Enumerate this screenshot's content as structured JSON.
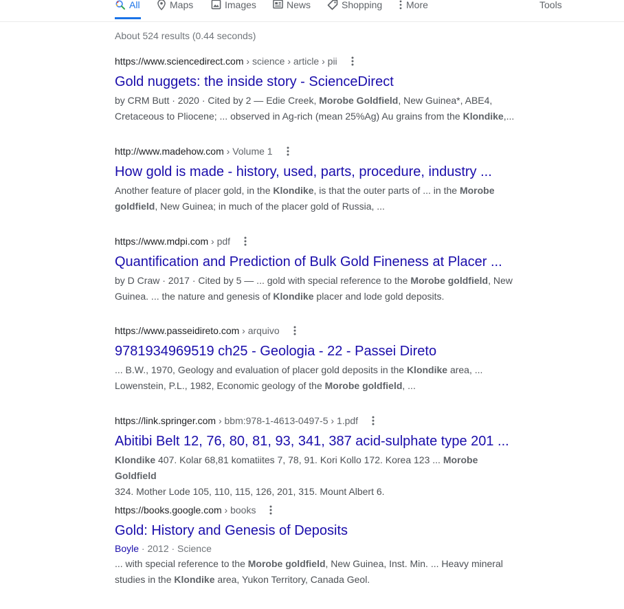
{
  "tabs": {
    "all": "All",
    "maps": "Maps",
    "images": "Images",
    "news": "News",
    "shopping": "Shopping",
    "more": "More",
    "tools": "Tools"
  },
  "stats": "About 524 results (0.44 seconds)",
  "colors": {
    "accent": "#1a73e8",
    "link": "#1a0dab"
  },
  "results": [
    {
      "domain": "https://www.sciencedirect.com",
      "path": " › science › article › pii",
      "title": "Gold nuggets: the inside story - ScienceDirect",
      "snippet": [
        "by CRM Butt · 2020 · Cited by 2 — Edie Creek, ",
        {
          "b": "Morobe Goldfield"
        },
        ", New Guinea*, ABE4,",
        {
          "br": true
        },
        "Cretaceous to Pliocene; ... observed in Ag-rich (mean 25%Ag) Au grains from the ",
        {
          "b": "Klondike"
        },
        ",..."
      ]
    },
    {
      "domain": "http://www.madehow.com",
      "path": " › Volume 1",
      "title": "How gold is made - history, used, parts, procedure, industry ...",
      "snippet": [
        "Another feature of placer gold, in the ",
        {
          "b": "Klondike"
        },
        ", is that the outer parts of ... in the ",
        {
          "b": "Morobe"
        },
        {
          "br": true
        },
        {
          "b": "goldfield"
        },
        ", New Guinea; in much of the placer gold of Russia, ..."
      ]
    },
    {
      "domain": "https://www.mdpi.com",
      "path": " › pdf",
      "title": "Quantification and Prediction of Bulk Gold Fineness at Placer ...",
      "snippet": [
        "by D Craw · 2017 · Cited by 5 — ... gold with special reference to the ",
        {
          "b": "Morobe goldfield"
        },
        ", New",
        {
          "br": true
        },
        "Guinea. ... the nature and genesis of ",
        {
          "b": "Klondike"
        },
        " placer and lode gold deposits."
      ]
    },
    {
      "domain": "https://www.passeidireto.com",
      "path": " › arquivo",
      "title": "9781934969519 ch25 - Geologia - 22 - Passei Direto",
      "snippet": [
        "... B.W., 1970, Geology and evaluation of placer gold deposits in the ",
        {
          "b": "Klondike"
        },
        " area, ...",
        {
          "br": true
        },
        "Lowenstein, P.L., 1982, Economic geology of the ",
        {
          "b": "Morobe goldfield"
        },
        ", ..."
      ]
    },
    {
      "domain": "https://link.springer.com",
      "path": " › bbm:978-1-4613-0497-5 › 1.pdf",
      "title": "Abitibi Belt 12, 76, 80, 81, 93, 341, 387 acid-sulphate type 201 ...",
      "snippet": [
        {
          "b": "Klondike"
        },
        " 407. Kolar 68,81 komatiites 7, 78, 91. Kori Kollo 172. Korea 123 ... ",
        {
          "b": "Morobe Goldfield"
        },
        {
          "br": true
        },
        "324. Mother Lode 105, 110, 115, 126, 201, 315. Mount Albert 6."
      ]
    },
    {
      "domain": "https://books.google.com",
      "path": " › books",
      "title": "Gold: History and Genesis of Deposits",
      "author": "Boyle",
      "meta": " · 2012 · Science",
      "snippet": [
        "... with special reference to the ",
        {
          "b": "Morobe goldfield"
        },
        ", New Guinea, Inst. Min. ... Heavy mineral",
        {
          "br": true
        },
        "studies in the ",
        {
          "b": "Klondike"
        },
        " area, Yukon Territory, Canada Geol."
      ]
    }
  ]
}
